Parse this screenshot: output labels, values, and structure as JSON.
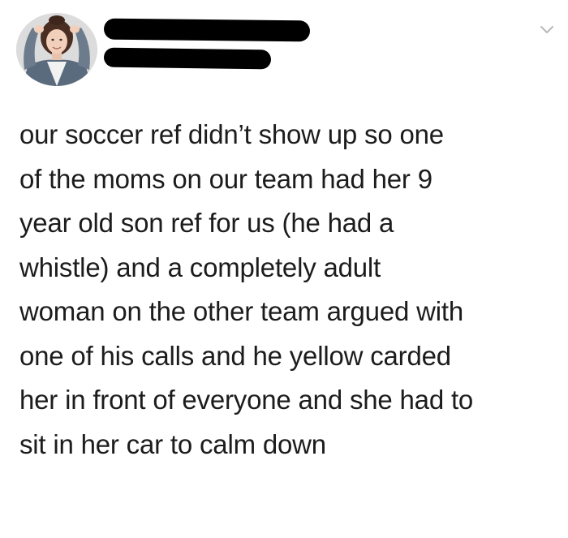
{
  "header": {
    "display_name": "",
    "handle": "",
    "menu_icon": "chevron-down-icon"
  },
  "tweet": {
    "lines": [
      "our soccer ref didn’t show up so one",
      "of the moms on our team had her 9",
      "year old son ref for us (he had a",
      "whistle) and a completely adult",
      "woman on the other team argued with",
      "one of his calls and he yellow carded",
      "her in front of everyone and she had to",
      "sit in her car to calm down"
    ]
  },
  "colors": {
    "background": "#ffffff",
    "text": "#1c1c1c",
    "redaction": "#000000",
    "chevron": "#b8b8b8"
  }
}
